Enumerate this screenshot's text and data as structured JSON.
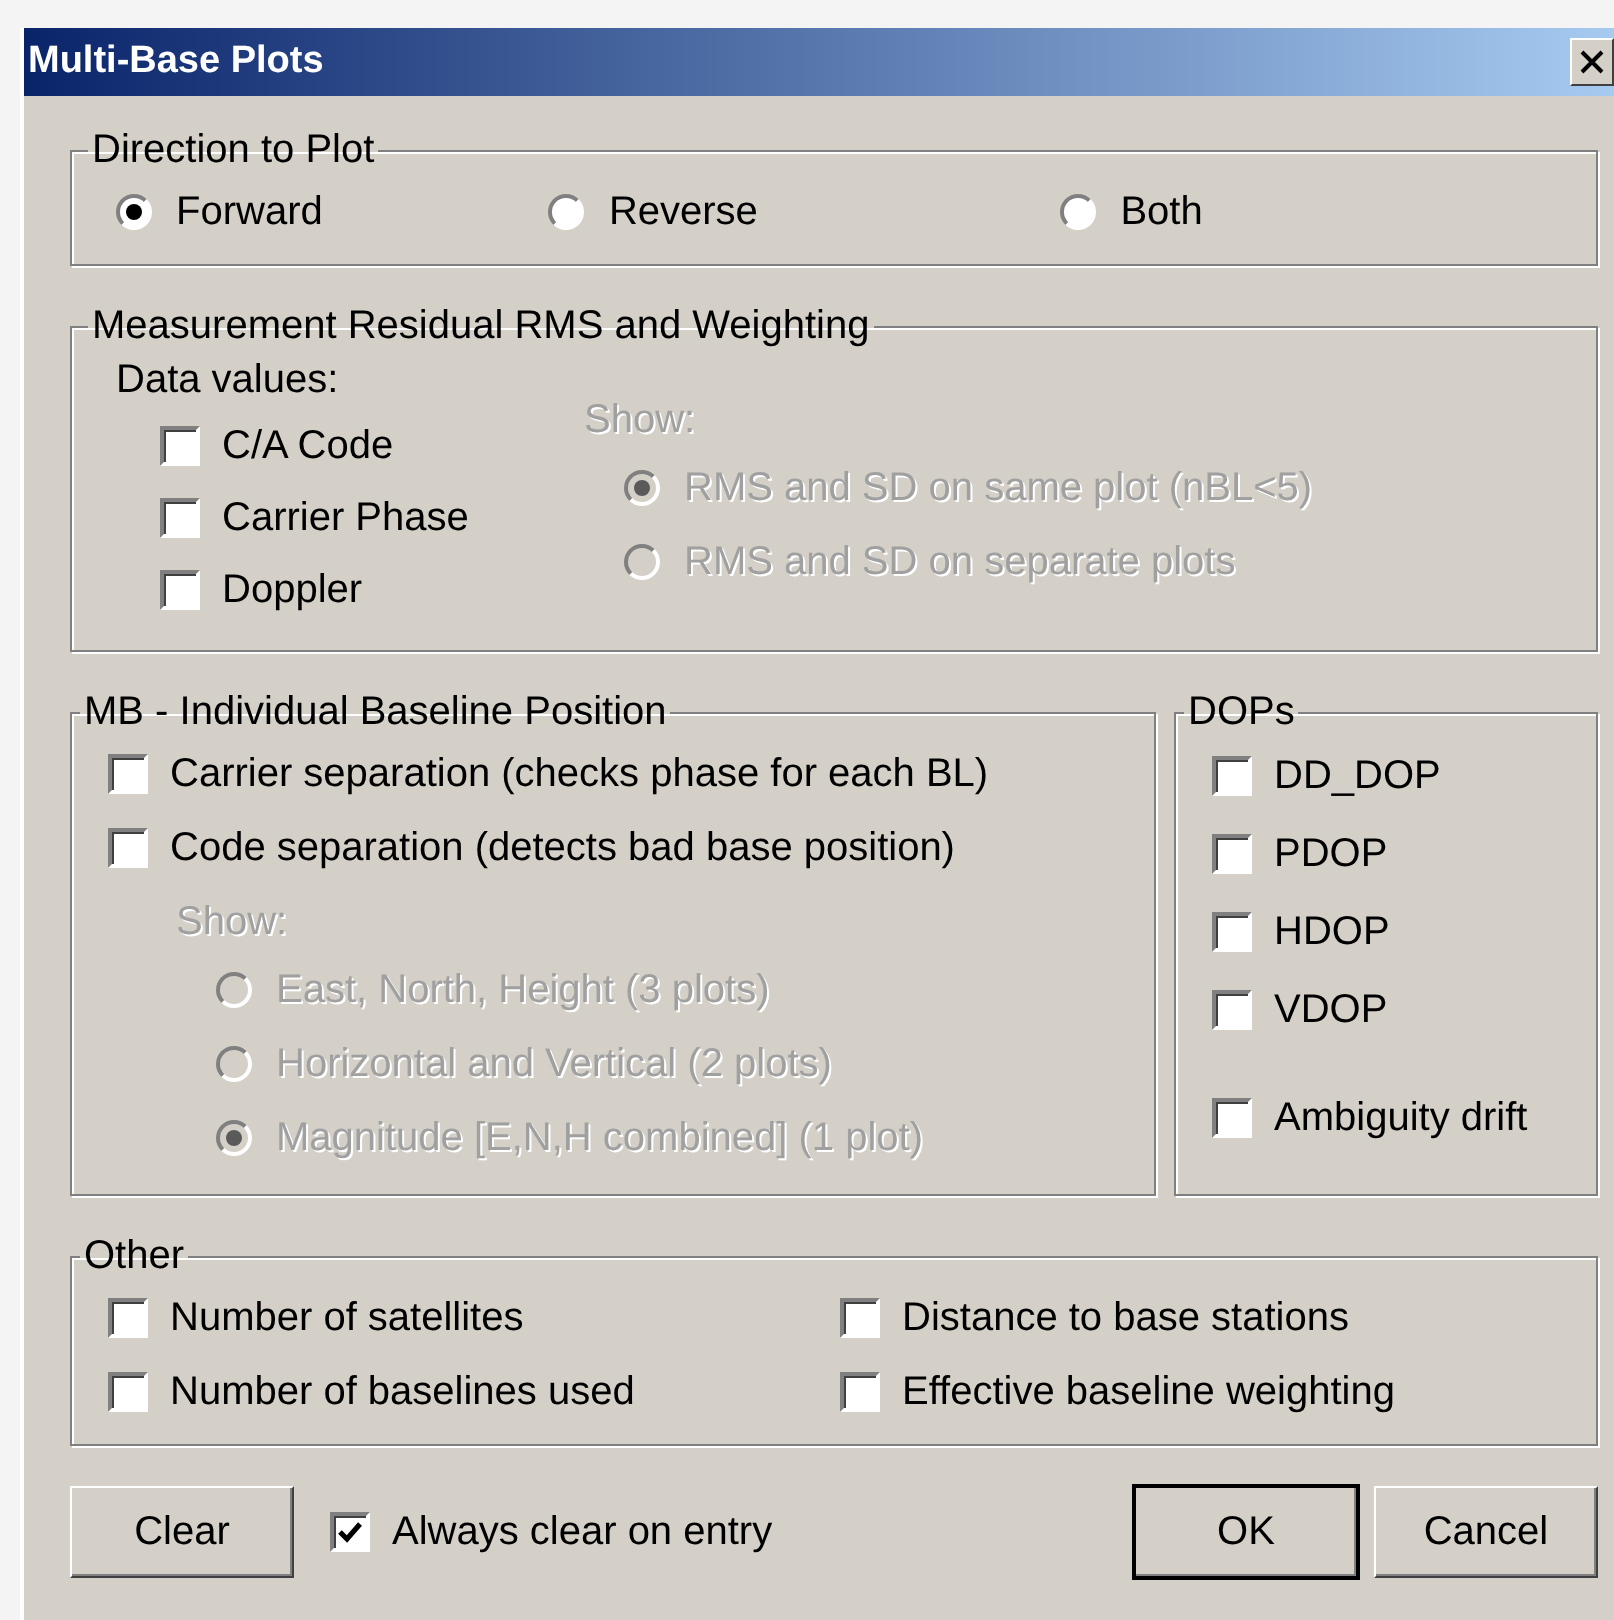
{
  "window": {
    "title": "Multi-Base Plots"
  },
  "direction": {
    "title": "Direction to Plot",
    "options": [
      {
        "label": "Forward",
        "selected": true
      },
      {
        "label": "Reverse",
        "selected": false
      },
      {
        "label": "Both",
        "selected": false
      }
    ]
  },
  "residual": {
    "title": "Measurement Residual RMS and Weighting",
    "data_label": "Data values:",
    "checks": [
      {
        "label": "C/A Code",
        "checked": false
      },
      {
        "label": "Carrier Phase",
        "checked": false
      },
      {
        "label": "Doppler",
        "checked": false
      }
    ],
    "show_label": "Show:",
    "show_disabled": true,
    "show_options": [
      {
        "label": "RMS and SD on same plot (nBL<5)",
        "selected": true
      },
      {
        "label": "RMS and SD on separate plots",
        "selected": false
      }
    ]
  },
  "baseline": {
    "title": "MB - Individual Baseline Position",
    "checks": [
      {
        "label": "Carrier separation (checks phase for each BL)",
        "checked": false
      },
      {
        "label": "Code separation (detects bad base position)",
        "checked": false
      }
    ],
    "show_label": "Show:",
    "show_disabled": true,
    "show_options": [
      {
        "label": "East, North, Height (3 plots)",
        "selected": false
      },
      {
        "label": "Horizontal and Vertical (2 plots)",
        "selected": false
      },
      {
        "label": "Magnitude [E,N,H combined]  (1 plot)",
        "selected": true
      }
    ]
  },
  "dops": {
    "title": "DOPs",
    "checks": [
      {
        "label": "DD_DOP",
        "checked": false
      },
      {
        "label": "PDOP",
        "checked": false
      },
      {
        "label": "HDOP",
        "checked": false
      },
      {
        "label": "VDOP",
        "checked": false
      }
    ],
    "extra_checks": [
      {
        "label": "Ambiguity drift",
        "checked": false
      }
    ]
  },
  "other": {
    "title": "Other",
    "checks": [
      {
        "label": "Number of satellites",
        "checked": false
      },
      {
        "label": "Distance to base stations",
        "checked": false
      },
      {
        "label": "Number of baselines used",
        "checked": false
      },
      {
        "label": "Effective baseline weighting",
        "checked": false
      }
    ]
  },
  "footer": {
    "clear_button": "Clear",
    "option": {
      "label": "Always clear on entry",
      "checked": true
    },
    "buttons": [
      {
        "label": "OK",
        "default": true
      },
      {
        "label": "Cancel",
        "default": false
      }
    ]
  }
}
